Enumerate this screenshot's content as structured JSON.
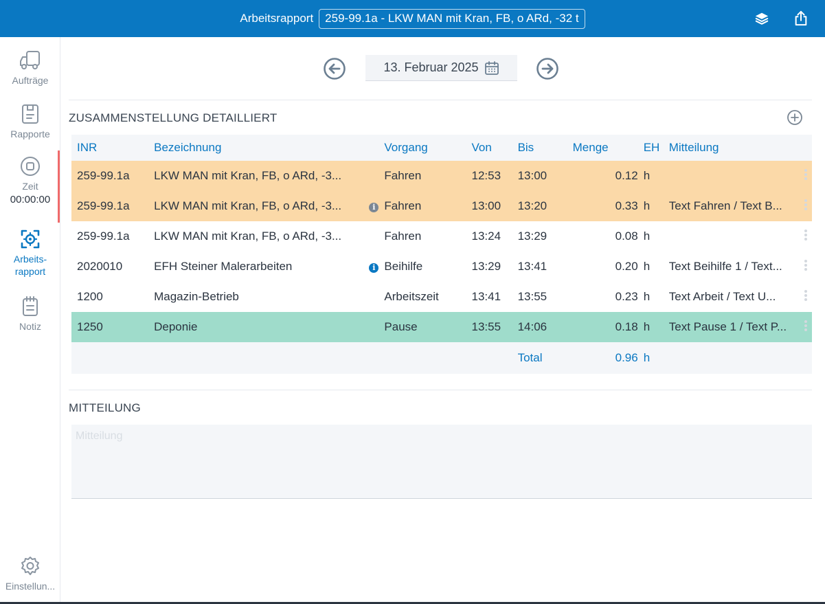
{
  "header": {
    "title": "Arbeitsrapport",
    "job_selector": "259-99.1a - LKW MAN mit Kran, FB, o ARd, -32 t",
    "layers_icon": "layers-icon",
    "share_icon": "share-icon"
  },
  "sidebar": {
    "items": [
      {
        "label": "Aufträge",
        "icon": "truck-icon"
      },
      {
        "label": "Rapporte",
        "icon": "clipboard-icon"
      },
      {
        "label": "Zeit",
        "icon": "stop-circle-icon",
        "timer": "00:00:00"
      },
      {
        "label": "Arbeits-",
        "label2": "rapport",
        "icon": "target-icon"
      },
      {
        "label": "Notiz",
        "icon": "notepad-icon"
      },
      {
        "label": "Einstellun...",
        "icon": "gear-icon"
      }
    ]
  },
  "date": {
    "value": "13. Februar 2025",
    "prev_icon": "arrow-left-circle-icon",
    "next_icon": "arrow-right-circle-icon"
  },
  "summary": {
    "title": "ZUSAMMENSTELLUNG DETAILLIERT",
    "columns": {
      "inr": "INR",
      "bezeichnung": "Bezeichnung",
      "vorgang": "Vorgang",
      "von": "Von",
      "bis": "Bis",
      "menge": "Menge",
      "eh": "EH",
      "mitteilung": "Mitteilung"
    },
    "rows": [
      {
        "inr": "259-99.1a",
        "bez": "LKW MAN mit Kran, FB, o ARd, -3...",
        "info": false,
        "vorgang": "Fahren",
        "von": "12:53",
        "bis": "13:00",
        "menge": "0.12",
        "eh": "h",
        "mit": "",
        "style": "orange"
      },
      {
        "inr": "259-99.1a",
        "bez": "LKW MAN mit Kran, FB, o ARd, -3...",
        "info": true,
        "vorgang": "Fahren",
        "von": "13:00",
        "bis": "13:20",
        "menge": "0.33",
        "eh": "h",
        "mit": "Text Fahren / Text B...",
        "style": "orange"
      },
      {
        "inr": "259-99.1a",
        "bez": "LKW MAN mit Kran, FB, o ARd, -3...",
        "info": false,
        "vorgang": "Fahren",
        "von": "13:24",
        "bis": "13:29",
        "menge": "0.08",
        "eh": "h",
        "mit": "",
        "style": "white"
      },
      {
        "inr": "2020010",
        "bez": "EFH Steiner Malerarbeiten",
        "info": true,
        "vorgang": "Beihilfe",
        "von": "13:29",
        "bis": "13:41",
        "menge": "0.20",
        "eh": "h",
        "mit": "Text Beihilfe 1 / Text...",
        "style": "white"
      },
      {
        "inr": "1200",
        "bez": "Magazin-Betrieb",
        "info": false,
        "vorgang": "Arbeitszeit",
        "von": "13:41",
        "bis": "13:55",
        "menge": "0.23",
        "eh": "h",
        "mit": "Text Arbeit / Text U...",
        "style": "white"
      },
      {
        "inr": "1250",
        "bez": "Deponie",
        "info": false,
        "vorgang": "Pause",
        "von": "13:55",
        "bis": "14:06",
        "menge": "0.18",
        "eh": "h",
        "mit": "Text Pause 1 / Text P...",
        "style": "green"
      }
    ],
    "total_label": "Total",
    "total_value": "0.96",
    "total_unit": "h"
  },
  "message": {
    "title": "MITTEILUNG",
    "placeholder": "Mitteilung"
  },
  "colors": {
    "primary": "#0a78c2",
    "row_orange": "#fbd9a8",
    "row_green": "#9fdccb",
    "active_marker": "#f06b6b"
  }
}
